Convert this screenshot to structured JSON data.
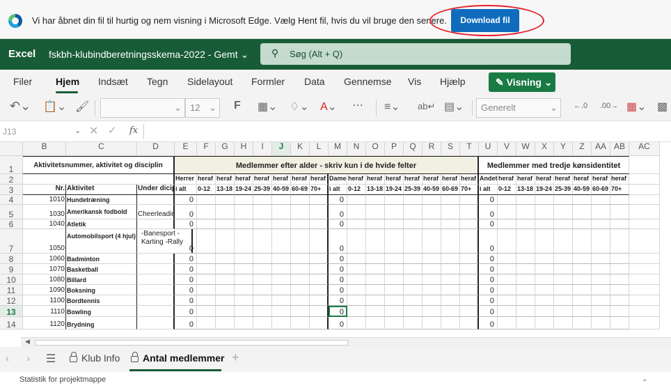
{
  "notification": {
    "message": "Vi har åbnet din fil til hurtig og nem visning i Microsoft Edge. Vælg Hent fil, hvis du vil bruge den senere.",
    "download_label": "Download fil"
  },
  "app": {
    "name": "Excel",
    "file_title": "fskbh-klubindberetningsskema-2022  -  Gemt ⌄",
    "search_placeholder": "Søg (Alt + Q)",
    "brand_color": "#185c37"
  },
  "menu": {
    "items": [
      "Filer",
      "Hjem",
      "Indsæt",
      "Tegn",
      "Sidelayout",
      "Formler",
      "Data",
      "Gennemse",
      "Vis",
      "Hjælp"
    ],
    "active": "Hjem",
    "view_button": "Visning ⌄"
  },
  "toolbar": {
    "font_size": "12",
    "number_format": "Generelt"
  },
  "formula_bar": {
    "name_box": "J13",
    "fx": "fx"
  },
  "grid": {
    "columns": [
      "B",
      "C",
      "D",
      "E",
      "F",
      "G",
      "H",
      "I",
      "J",
      "K",
      "L",
      "M",
      "N",
      "O",
      "P",
      "Q",
      "R",
      "S",
      "T",
      "U",
      "V",
      "W",
      "X",
      "Y",
      "Z",
      "AA",
      "AB",
      "AC"
    ],
    "selected_column": "J",
    "selected_row": "13",
    "header_row1": {
      "aktivitet": "Aktivitetsnummer, aktivitet og disciplin",
      "medlemmer_alder": "Medlemmer efter alder - skriv kun i de hvide felter",
      "medlemmer_tredje": "Medlemmer med tredje kønsidentitet"
    },
    "row2": [
      "Herrer",
      "heraf",
      "heraf",
      "heraf",
      "heraf",
      "heraf",
      "heraf",
      "heraf",
      "Damer",
      "heraf",
      "heraf",
      "heraf",
      "heraf",
      "heraf",
      "heraf",
      "heraf",
      "Andet",
      "heraf",
      "heraf",
      "heraf",
      "heraf",
      "heraf",
      "heraf",
      "heraf"
    ],
    "row3_labels": [
      "Nr.",
      "Aktivitet",
      "Under dicipliner"
    ],
    "row3": [
      "i alt",
      "0-12",
      "13-18",
      "19-24",
      "25-39",
      "40-59",
      "60-69",
      "70+",
      "i alt",
      "0-12",
      "13-18",
      "19-24",
      "25-39",
      "40-59",
      "60-69",
      "70+",
      "i alt",
      "0-12",
      "13-18",
      "19-24",
      "25-39",
      "40-59",
      "60-69",
      "70+"
    ],
    "rows": [
      {
        "row": "4",
        "nr": "1010",
        "aktivitet": "Hundetræning",
        "under": "",
        "herrer": "0",
        "damer": "0",
        "andet": "0"
      },
      {
        "row": "5",
        "nr": "1030",
        "aktivitet": "Amerikansk fodbold",
        "under": "Cheerleading",
        "herrer": "0",
        "damer": "0",
        "andet": "0"
      },
      {
        "row": "6",
        "nr": "1040",
        "aktivitet": "Atletik",
        "under": "",
        "herrer": "0",
        "damer": "0",
        "andet": "0"
      },
      {
        "row": "7",
        "nr": "1050",
        "aktivitet": "Automobilsport (4 hjul)",
        "under": "-Banesport -Karting -Rally",
        "herrer": "0",
        "damer": "0",
        "andet": "0"
      },
      {
        "row": "8",
        "nr": "1060",
        "aktivitet": "Badminton",
        "under": "",
        "herrer": "0",
        "damer": "0",
        "andet": "0"
      },
      {
        "row": "9",
        "nr": "1070",
        "aktivitet": "Basketball",
        "under": "",
        "herrer": "0",
        "damer": "0",
        "andet": "0"
      },
      {
        "row": "10",
        "nr": "1080",
        "aktivitet": "Billard",
        "under": "",
        "herrer": "0",
        "damer": "0",
        "andet": "0"
      },
      {
        "row": "11",
        "nr": "1090",
        "aktivitet": "Boksning",
        "under": "",
        "herrer": "0",
        "damer": "0",
        "andet": "0"
      },
      {
        "row": "12",
        "nr": "1100",
        "aktivitet": "Bordtennis",
        "under": "",
        "herrer": "0",
        "damer": "0",
        "andet": "0"
      },
      {
        "row": "13",
        "nr": "1110",
        "aktivitet": "Bowling",
        "under": "",
        "herrer": "0",
        "damer": "0",
        "andet": "0"
      },
      {
        "row": "14",
        "nr": "1120",
        "aktivitet": "Brydning",
        "under": "",
        "herrer": "0",
        "damer": "0",
        "andet": "0"
      }
    ]
  },
  "sheets": {
    "tabs": [
      "Klub Info",
      "Antal medlemmer"
    ],
    "active": "Antal medlemmer"
  },
  "status": {
    "text": "Statistik for projektmappe"
  }
}
